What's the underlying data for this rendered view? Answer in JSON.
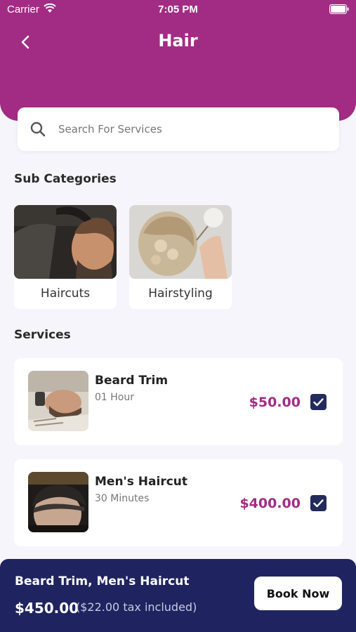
{
  "status_bar": {
    "carrier": "Carrier",
    "time": "7:05 PM"
  },
  "header": {
    "title": "Hair"
  },
  "search": {
    "placeholder": "Search For Services",
    "value": ""
  },
  "sub_categories": {
    "title": "Sub Categories",
    "items": [
      {
        "label": "Haircuts"
      },
      {
        "label": "Hairstyling"
      }
    ]
  },
  "services": {
    "title": "Services",
    "items": [
      {
        "name": "Beard Trim",
        "duration": "01 Hour",
        "price": "$50.00",
        "checked": true
      },
      {
        "name": "Men's Haircut",
        "duration": "30 Minutes",
        "price": "$400.00",
        "checked": true
      }
    ]
  },
  "bottom_bar": {
    "selected": "Beard Trim, Men's Haircut",
    "total": "$450.00",
    "tax_note": "($22.00 tax included)",
    "book_label": "Book Now"
  },
  "colors": {
    "header": "#a22c84",
    "price": "#a22c84",
    "bottom_bar": "#1f2460",
    "checkbox": "#232a5c"
  }
}
